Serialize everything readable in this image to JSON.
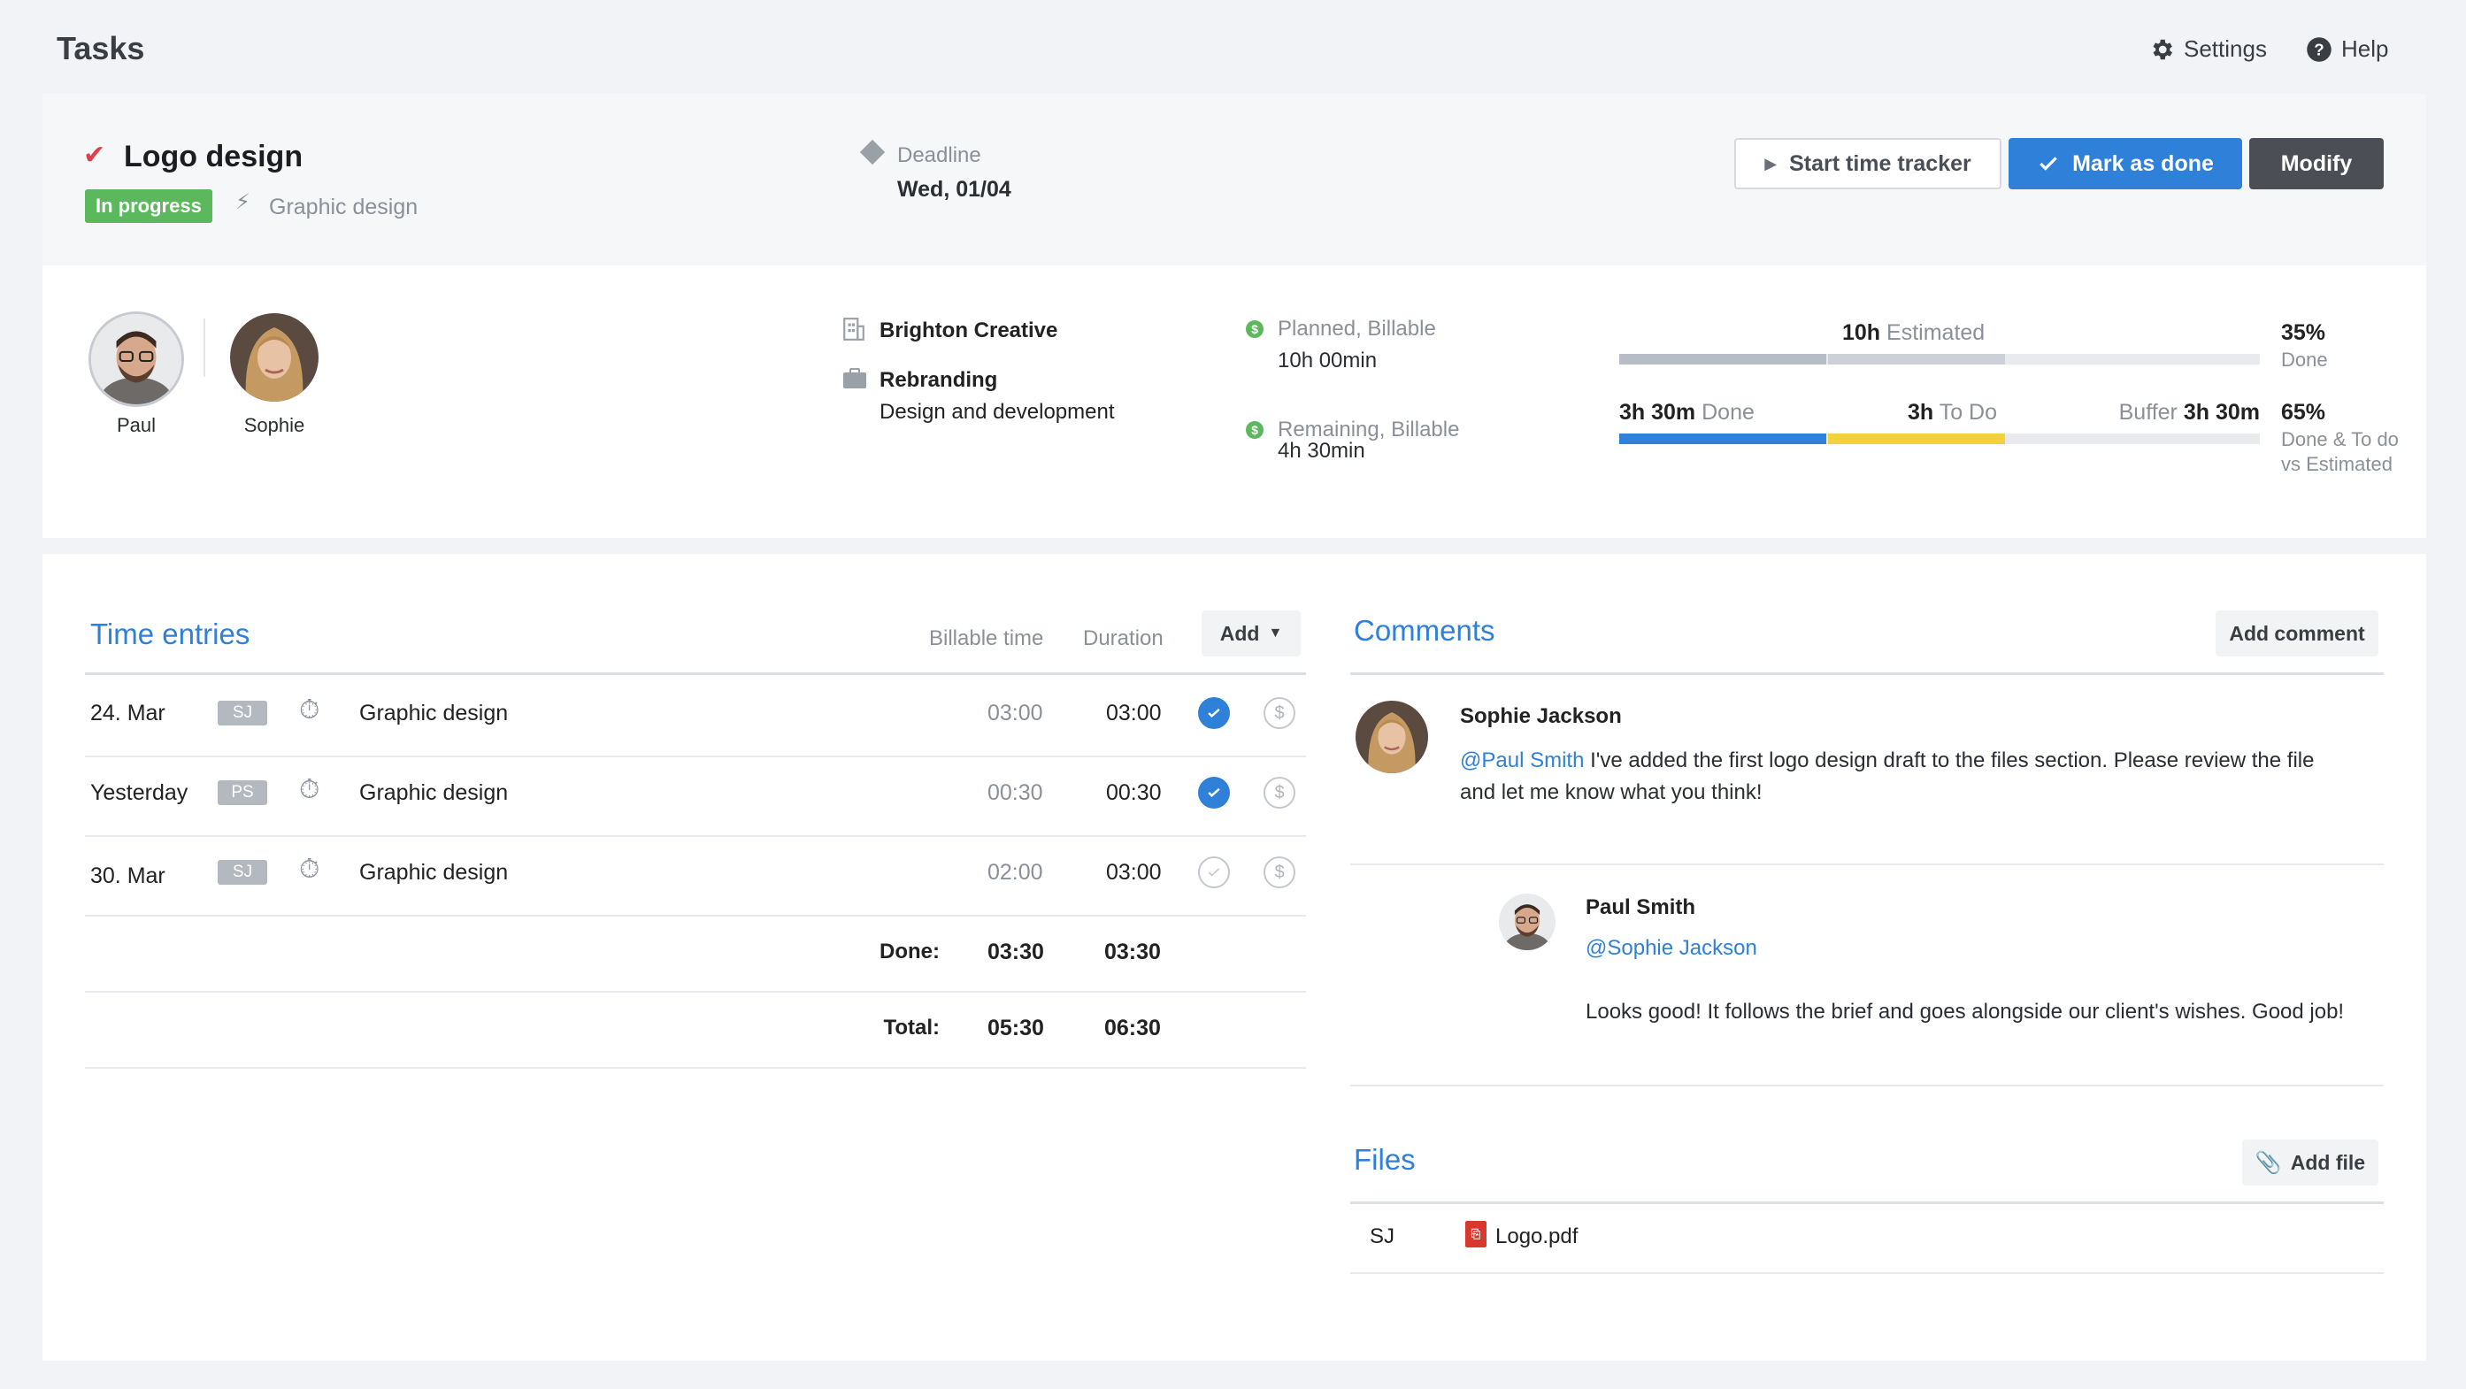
{
  "topbar": {
    "title": "Tasks",
    "settings_label": "Settings",
    "help_label": "Help"
  },
  "task": {
    "title": "Logo design",
    "status": "In progress",
    "category": "Graphic design",
    "deadline_label": "Deadline",
    "deadline_value": "Wed, 01/04",
    "actions": {
      "start_tracker": "Start time tracker",
      "mark_done": "Mark as done",
      "modify": "Modify"
    }
  },
  "assignees": [
    {
      "name": "Paul"
    },
    {
      "name": "Sophie"
    }
  ],
  "project": {
    "client": "Brighton Creative",
    "project": "Rebranding",
    "subtitle": "Design and development"
  },
  "budget": {
    "planned_label": "Planned, Billable",
    "planned_value": "10h 00min",
    "remaining_label": "Remaining, Billable",
    "remaining_value": "4h 30min",
    "estimated_value": "10h",
    "estimated_label": "Estimated",
    "done_value": "3h 30m",
    "done_label": "Done",
    "todo_value": "3h",
    "todo_label": "To Do",
    "buffer_label": "Buffer",
    "buffer_value": "3h 30m",
    "pct_done": "35%",
    "pct_done_label": "Done",
    "pct_total": "65%",
    "pct_total_label_1": "Done & To do",
    "pct_total_label_2": "vs Estimated",
    "colors": {
      "done": "#2f80d8",
      "todo": "#f2d13c",
      "estimated": "#b8bcc4",
      "track": "#e8eaee"
    }
  },
  "time_entries": {
    "title": "Time entries",
    "col_billable": "Billable time",
    "col_duration": "Duration",
    "add_label": "Add",
    "rows": [
      {
        "date": "24. Mar",
        "initials": "SJ",
        "task": "Graphic design",
        "billable": "03:00",
        "duration": "03:00",
        "billed": true
      },
      {
        "date": "Yesterday",
        "initials": "PS",
        "task": "Graphic design",
        "billable": "00:30",
        "duration": "00:30",
        "billed": true
      },
      {
        "date": "30. Mar",
        "initials": "SJ",
        "task": "Graphic design",
        "billable": "02:00",
        "duration": "03:00",
        "billed": false
      }
    ],
    "done_label": "Done:",
    "done_billable": "03:30",
    "done_duration": "03:30",
    "total_label": "Total:",
    "total_billable": "05:30",
    "total_duration": "06:30"
  },
  "comments": {
    "title": "Comments",
    "add_label": "Add comment",
    "items": [
      {
        "author": "Sophie Jackson",
        "mention": "@Paul Smith",
        "text_1": " I've added the first logo design draft to the files section. Please review the file",
        "text_2": "and let me know what you think!"
      },
      {
        "author": "Paul Smith",
        "mention": "@Sophie Jackson",
        "text_1": "Looks good! It follows the brief and goes alongside our client's wishes. Good job!"
      }
    ]
  },
  "files": {
    "title": "Files",
    "add_label": "Add file",
    "items": [
      {
        "owner": "SJ",
        "name": "Logo.pdf"
      }
    ]
  }
}
